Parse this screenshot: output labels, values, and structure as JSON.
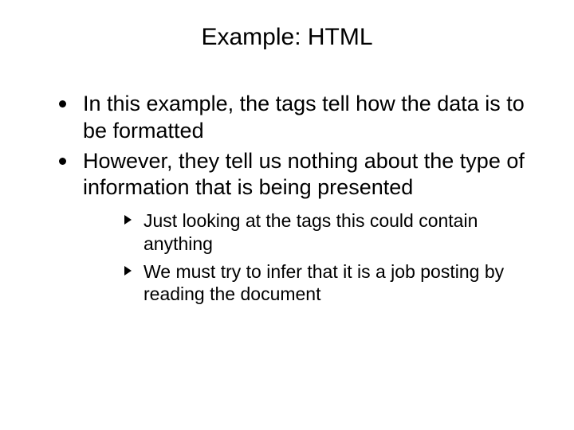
{
  "title": "Example: HTML",
  "bullets": {
    "b1": "In this example, the tags tell how the data is to be formatted",
    "b2": "However, they tell us nothing about the type of information that is being presented"
  },
  "subbullets": {
    "s1": "Just looking at the tags this could contain anything",
    "s2": "We must try to infer that it is a job posting by reading the document"
  }
}
